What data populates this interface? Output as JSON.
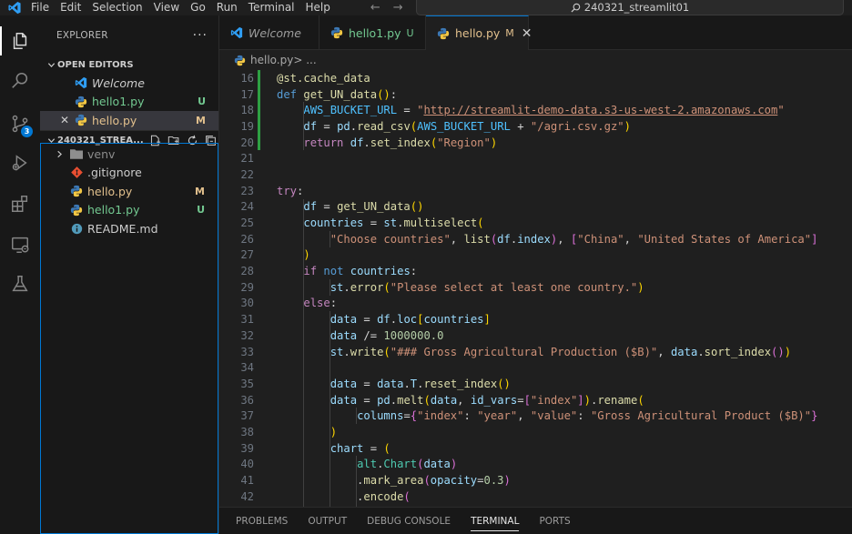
{
  "menu": [
    "File",
    "Edit",
    "Selection",
    "View",
    "Go",
    "Run",
    "Terminal",
    "Help"
  ],
  "search": {
    "text": "240321_streamlit01"
  },
  "activity": {
    "scm_badge": "3"
  },
  "explorer": {
    "title": "EXPLORER",
    "more": "···",
    "open_editors": {
      "title": "OPEN EDITORS",
      "items": [
        {
          "name": "Welcome",
          "status": ""
        },
        {
          "name": "hello1.py",
          "status": "U"
        },
        {
          "name": "hello.py",
          "status": "M"
        }
      ]
    },
    "project": {
      "title": "240321_STREA...",
      "items": [
        {
          "name": "venv",
          "status": ""
        },
        {
          "name": ".gitignore",
          "status": ""
        },
        {
          "name": "hello.py",
          "status": "M"
        },
        {
          "name": "hello1.py",
          "status": "U"
        },
        {
          "name": "README.md",
          "status": ""
        }
      ]
    }
  },
  "tabs": [
    {
      "label": "Welcome",
      "status": ""
    },
    {
      "label": "hello1.py",
      "status": "U"
    },
    {
      "label": "hello.py",
      "status": "M"
    }
  ],
  "breadcrumb": {
    "file": "hello.py",
    "sep": " > ...",
    "close": "✕"
  },
  "code": {
    "line_numbers": [
      "16",
      "17",
      "18",
      "19",
      "20",
      "21",
      "22",
      "23",
      "24",
      "25",
      "26",
      "27",
      "28",
      "29",
      "30",
      "31",
      "32",
      "33",
      "34",
      "35",
      "36",
      "37",
      "38",
      "39",
      "40",
      "41",
      "42"
    ]
  },
  "panel": {
    "tabs": [
      "PROBLEMS",
      "OUTPUT",
      "DEBUG CONSOLE",
      "TERMINAL",
      "PORTS"
    ]
  }
}
